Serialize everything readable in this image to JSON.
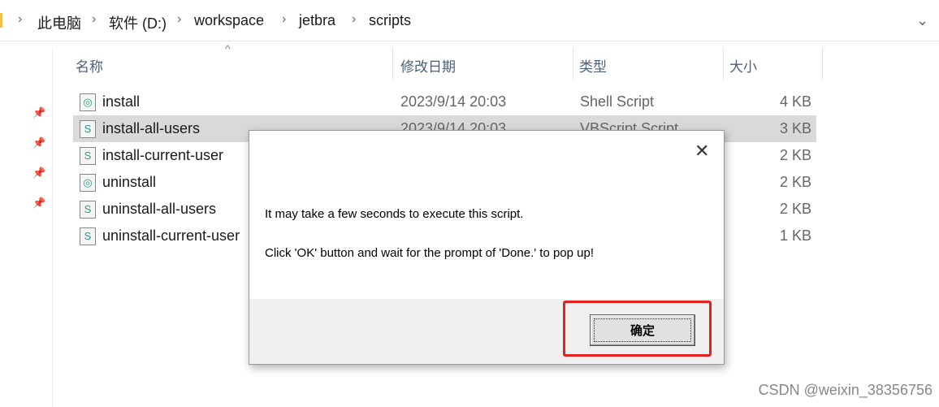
{
  "breadcrumb": [
    "此电脑",
    "软件 (D:)",
    "workspace",
    "jetbra",
    "scripts"
  ],
  "columns": {
    "name": "名称",
    "date": "修改日期",
    "type": "类型",
    "size": "大小"
  },
  "files": [
    {
      "name": "install",
      "date": "2023/9/14 20:03",
      "type": "Shell Script",
      "size": "4 KB",
      "icon": "shell-script-icon"
    },
    {
      "name": "install-all-users",
      "date": "2023/9/14 20:03",
      "type": "VBScript Script",
      "size": "3 KB",
      "icon": "vbscript-icon"
    },
    {
      "name": "install-current-user",
      "date": "",
      "type": "",
      "size": "2 KB",
      "icon": "vbscript-icon"
    },
    {
      "name": "uninstall",
      "date": "",
      "type": "",
      "size": "2 KB",
      "icon": "shell-script-icon"
    },
    {
      "name": "uninstall-all-users",
      "date": "",
      "type": "",
      "size": "2 KB",
      "icon": "vbscript-icon"
    },
    {
      "name": "uninstall-current-user",
      "date": "",
      "type": "",
      "size": "1 KB",
      "icon": "vbscript-icon"
    }
  ],
  "dialog": {
    "line1": "It may take a few seconds to execute this script.",
    "line2": "Click 'OK' button and wait for the prompt of 'Done.' to pop up!",
    "ok_label": "确定",
    "close": "✕"
  },
  "highlight_color": "#e5201f",
  "watermark": "CSDN @weixin_38356756"
}
